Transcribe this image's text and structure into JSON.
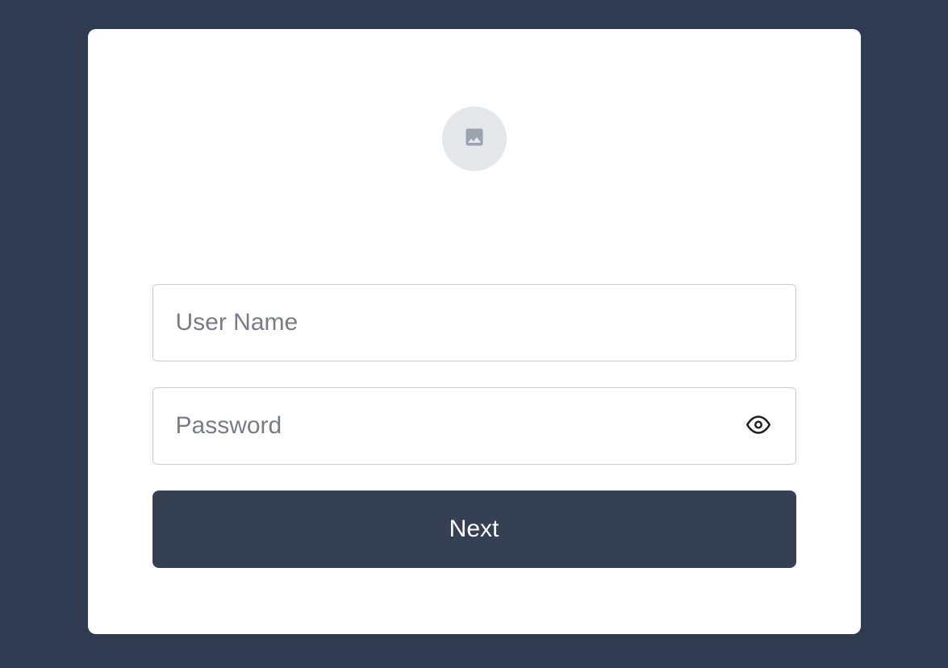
{
  "login": {
    "username_placeholder": "User Name",
    "password_placeholder": "Password",
    "next_label": "Next"
  }
}
